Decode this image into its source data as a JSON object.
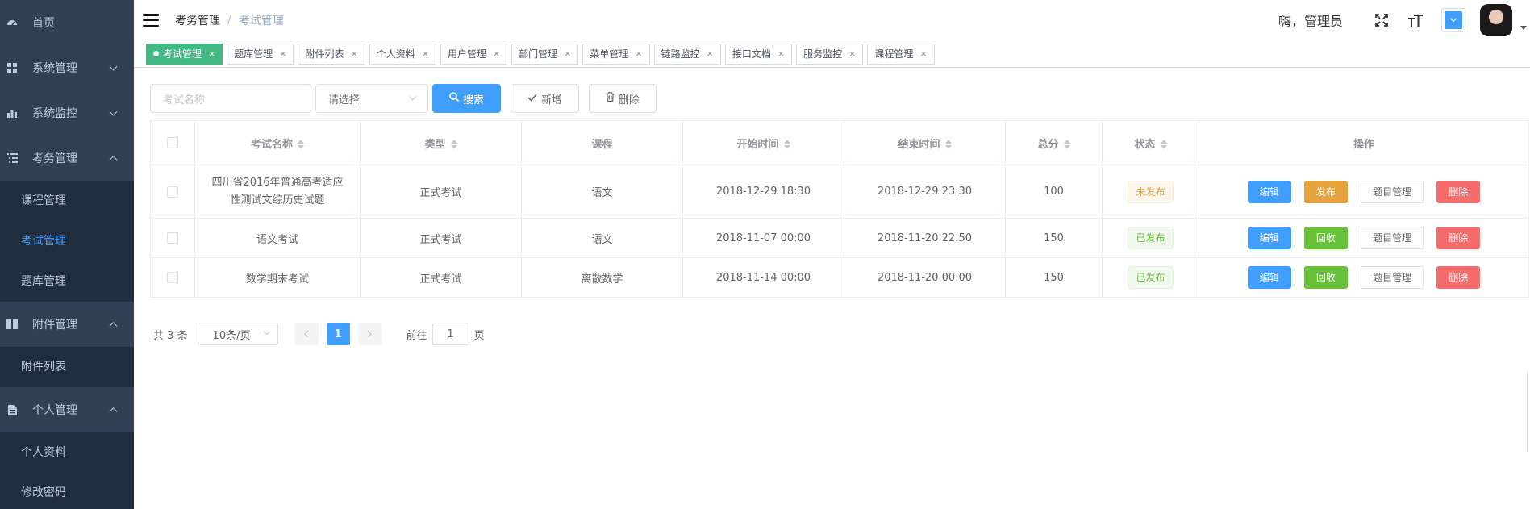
{
  "sidebar": {
    "items": [
      {
        "label": "首页",
        "icon": "dashboard-icon"
      },
      {
        "label": "系统管理",
        "icon": "grid-icon"
      },
      {
        "label": "系统监控",
        "icon": "bar-chart-icon"
      },
      {
        "label": "考务管理",
        "icon": "list-icon",
        "children": [
          "课程管理",
          "考试管理",
          "题库管理"
        ]
      },
      {
        "label": "附件管理",
        "icon": "book-icon",
        "children": [
          "附件列表"
        ]
      },
      {
        "label": "个人管理",
        "icon": "document-icon",
        "children": [
          "个人资料",
          "修改密码"
        ]
      }
    ]
  },
  "navbar": {
    "breadcrumb": [
      "考务管理",
      "考试管理"
    ],
    "greeting": "嗨，管理员"
  },
  "tags": [
    "考试管理",
    "题库管理",
    "附件列表",
    "个人资料",
    "用户管理",
    "部门管理",
    "菜单管理",
    "链路监控",
    "接口文档",
    "服务监控",
    "课程管理"
  ],
  "filter": {
    "name_placeholder": "考试名称",
    "select_value": "请选择",
    "search": "搜索",
    "add": "新增",
    "delete": "删除"
  },
  "table": {
    "headers": [
      "考试名称",
      "类型",
      "课程",
      "开始时间",
      "结束时间",
      "总分",
      "状态",
      "操作"
    ],
    "rows": [
      {
        "name": "四川省2016年普通高考适应性测试文综历史试题",
        "type": "正式考试",
        "course": "语文",
        "start": "2018-12-29 18:30",
        "end": "2018-12-29 23:30",
        "score": "100",
        "status": "未发布",
        "toggle": "发布"
      },
      {
        "name": "语文考试",
        "type": "正式考试",
        "course": "语文",
        "start": "2018-11-07 00:00",
        "end": "2018-11-20 22:50",
        "score": "150",
        "status": "已发布",
        "toggle": "回收"
      },
      {
        "name": "数学期末考试",
        "type": "正式考试",
        "course": "离散数学",
        "start": "2018-11-14 00:00",
        "end": "2018-11-20 00:00",
        "score": "150",
        "status": "已发布",
        "toggle": "回收"
      }
    ],
    "actions": {
      "edit": "编辑",
      "questions": "题目管理",
      "delete": "删除"
    }
  },
  "pagination": {
    "total": "共 3 条",
    "page_size": "10条/页",
    "current": "1",
    "goto_prefix": "前往",
    "goto_value": "1",
    "goto_suffix": "页"
  }
}
